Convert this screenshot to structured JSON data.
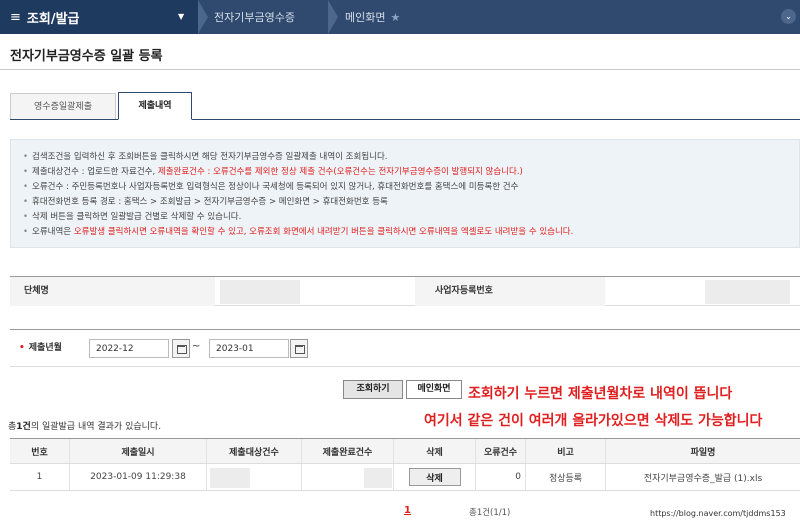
{
  "topbar": {
    "menu_title": "조회/발급",
    "breadcrumbs": [
      "전자기부금영수증",
      "메인화면"
    ]
  },
  "page_title": "전자기부금영수증 일괄 등록",
  "tabs": [
    {
      "label": "영수증일괄제출",
      "active": false
    },
    {
      "label": "제출내역",
      "active": true
    }
  ],
  "info": {
    "line1": "검색조건을 입력하신 후 조회버튼을 클릭하시면 해당 전자기부금영수증 일괄제출 내역이 조회됩니다.",
    "line2_a": "제출대상건수 : 업로드한 자료건수, ",
    "line2_red": "제출완료건수 : 오류건수를 제외한 정상 제출 건수(오류건수는 전자기부금영수증이 발행되지 않습니다.)",
    "line3": "오류건수 : 주민등록번호나 사업자등록번호 입력형식은 정상이나 국세청에 등록되어 있지 않거나, 휴대전화번호를 홈택스에 미등록한 건수",
    "line4": "휴대전화번호 등록 경로 : 홈택스 > 조회발급 > 전자기부금영수증 > 메인화면 > 휴대전화번호 등록",
    "line5": "삭제 버튼을 클릭하면 일괄발급 건별로 삭제할 수 있습니다.",
    "line6_a": "오류내역은 ",
    "line6_red": "오류발생 클릭하시면 오류내역을 확인할 수 있고, 오류조회 화면에서 내려받기 버튼을 클릭하시면 오류내역을 엑셀로도 내려받을 수 있습니다."
  },
  "group": {
    "name_label": "단체명",
    "bizno_label": "사업자등록번호"
  },
  "date_search": {
    "label": "제출년월",
    "from": "2022-12",
    "to": "2023-01",
    "separator": "~"
  },
  "buttons": {
    "search": "조회하기",
    "main": "메인화면"
  },
  "annotations": {
    "line1": "조회하기 누르면 제출년월차로 내역이 뜹니다",
    "line2": "여기서 같은 건이 여러개 올라가있으면 삭제도 가능합니다"
  },
  "result_summary": {
    "prefix": "총",
    "count": "1건",
    "suffix": "의 일괄발급 내역 결과가 있습니다."
  },
  "table": {
    "headers": [
      "번호",
      "제출일시",
      "제출대상건수",
      "제출완료건수",
      "삭제",
      "오류건수",
      "비고",
      "파일명"
    ],
    "rows": [
      {
        "no": "1",
        "datetime": "2023-01-09 11:29:38",
        "delete_label": "삭제",
        "errors": "0",
        "note": "정상등록",
        "filename": "전자기부금영수증_발급 (1).xls"
      }
    ]
  },
  "pagination": {
    "current": "1",
    "total": "총1건(1/1)"
  },
  "watermark": "https://blog.naver.com/tjddms153"
}
